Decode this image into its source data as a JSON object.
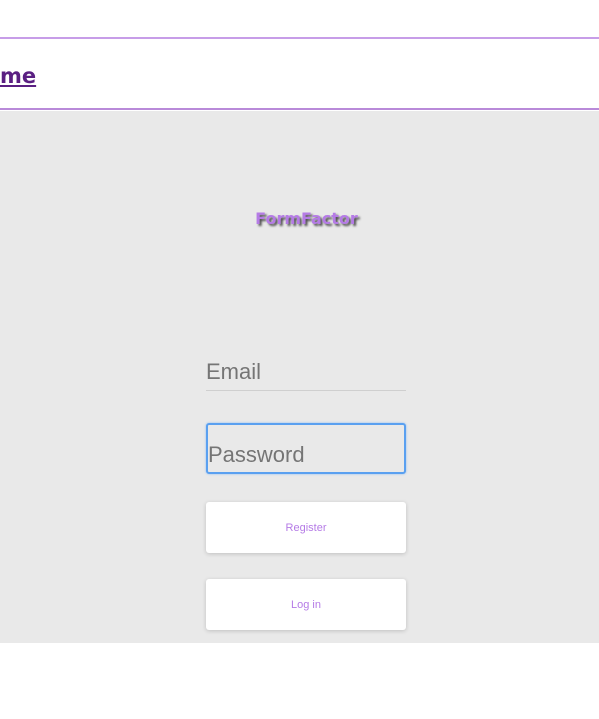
{
  "nav": {
    "link_label": "me"
  },
  "logo": {
    "text": "FormFactor"
  },
  "form": {
    "email_placeholder": "Email",
    "password_placeholder": "Password",
    "register_label": "Register",
    "login_label": "Log in"
  },
  "colors": {
    "accent": "#b57be6",
    "nav_link": "#5a1f82",
    "panel_bg": "#e9e9e9",
    "focus_outline": "#5aa0f0"
  }
}
